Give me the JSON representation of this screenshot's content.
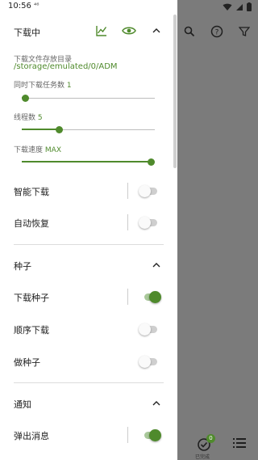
{
  "status_bar": {
    "time": "10:56",
    "network": "⁴⁶"
  },
  "download_section": {
    "title": "下载中",
    "dir_label": "下载文件存放目录",
    "dir_path": "/storage/emulated/0/ADM",
    "concurrent_label": "同时下载任务数",
    "concurrent_value": "1",
    "concurrent_fraction": 0.0,
    "threads_label": "线程数",
    "threads_value": "5",
    "threads_fraction": 0.27,
    "speed_label": "下载速度",
    "speed_value": "MAX",
    "speed_fraction": 1.0,
    "smart_download_label": "智能下载",
    "smart_download_on": false,
    "auto_resume_label": "自动恢复",
    "auto_resume_on": false
  },
  "torrent_section": {
    "title": "种子",
    "download_torrent_label": "下载种子",
    "download_torrent_on": true,
    "sequential_label": "顺序下载",
    "sequential_on": false,
    "seeding_label": "做种子",
    "seeding_on": false
  },
  "notify_section": {
    "title": "通知",
    "popup_label": "弹出消息",
    "popup_on": true
  },
  "bottom_bar": {
    "done_label": "已完成",
    "done_count": "0"
  },
  "colors": {
    "accent": "#4f8a2c",
    "scrim": "#7b7b7b"
  }
}
